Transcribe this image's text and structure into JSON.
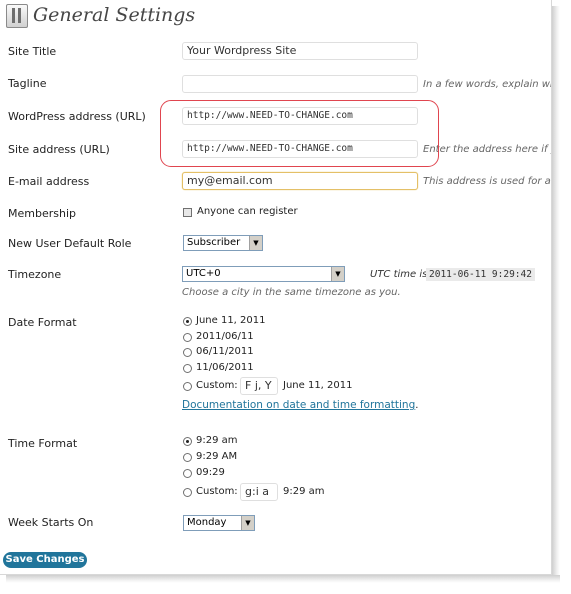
{
  "header": {
    "title": "General Settings",
    "icon": "settings-icon"
  },
  "site_title": {
    "label": "Site Title",
    "value": "Your Wordpress Site"
  },
  "tagline": {
    "label": "Tagline",
    "value": "",
    "description": "In a few words, explain wha"
  },
  "wp_address": {
    "label": "WordPress address (URL)",
    "value": "http://www.NEED-TO-CHANGE.com"
  },
  "site_address": {
    "label": "Site address (URL)",
    "value": "http://www.NEED-TO-CHANGE.com",
    "description": "Enter the address here if yo"
  },
  "email": {
    "label": "E-mail address",
    "value": "my@email.com",
    "description": "This address is used for adr"
  },
  "membership": {
    "label": "Membership",
    "checkbox_label": "Anyone can register",
    "checked": false
  },
  "default_role": {
    "label": "New User Default Role",
    "selected": "Subscriber"
  },
  "timezone": {
    "label": "Timezone",
    "selected": "UTC+0",
    "utc_label": "UTC time is",
    "utc_time": "2011-06-11 9:29:42",
    "hint": "Choose a city in the same timezone as you."
  },
  "date_format": {
    "label": "Date Format",
    "options": [
      "June 11, 2011",
      "2011/06/11",
      "06/11/2011",
      "11/06/2011"
    ],
    "custom_label": "Custom:",
    "custom_value": "F j, Y",
    "custom_preview": "June 11, 2011",
    "doc_link": "Documentation on date and time formatting",
    "doc_suffix": "."
  },
  "time_format": {
    "label": "Time Format",
    "options": [
      "9:29 am",
      "9:29 AM",
      "09:29"
    ],
    "custom_label": "Custom:",
    "custom_value": "g:i a",
    "custom_preview": "9:29 am"
  },
  "week_start": {
    "label": "Week Starts On",
    "selected": "Monday"
  },
  "save_label": "Save Changes",
  "colors": {
    "accent": "#21759b",
    "highlight": "#e0454f",
    "focus": "#e4c067"
  }
}
